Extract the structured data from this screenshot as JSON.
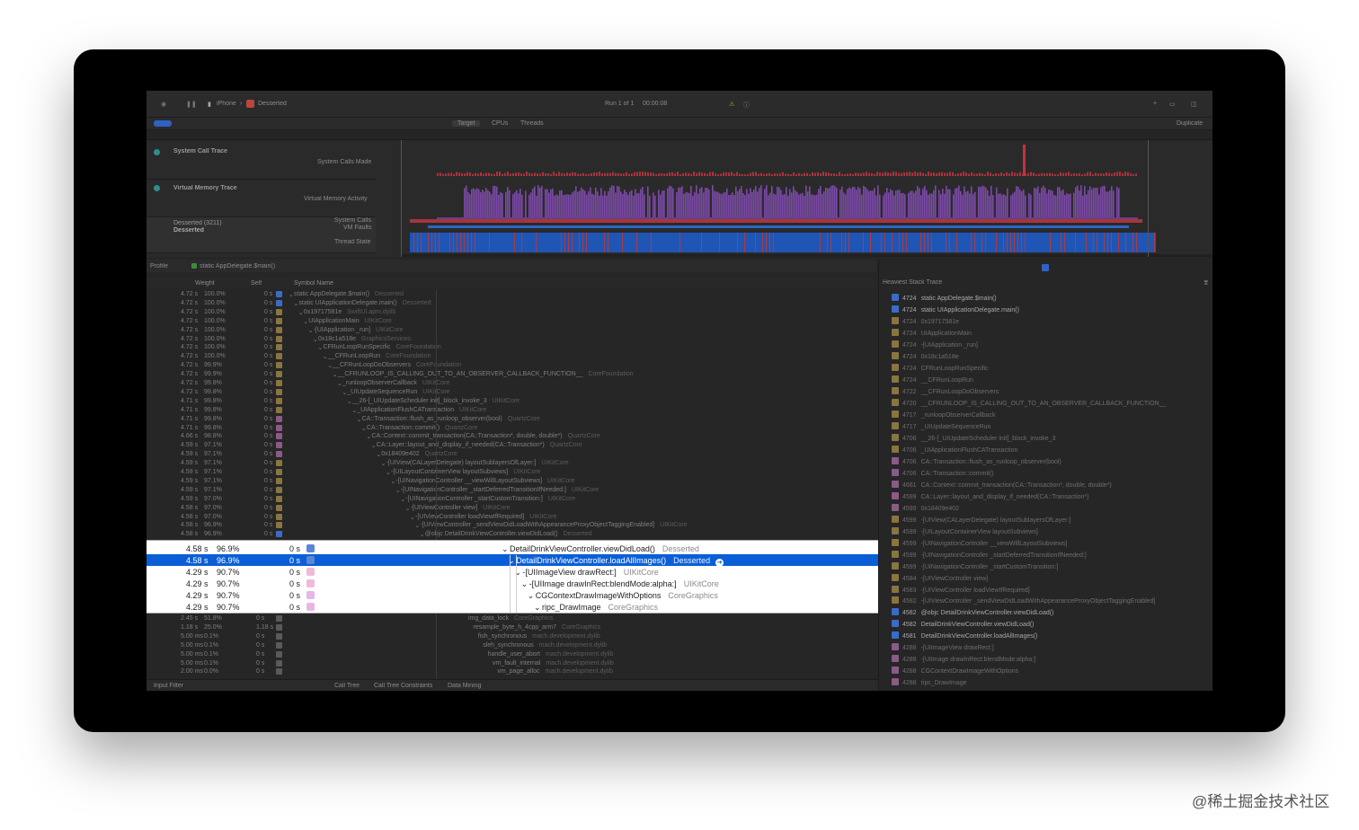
{
  "toolbar": {
    "device": "iPhone",
    "app": "Desserted",
    "run_status": "Run 1 of 1",
    "run_time": "00:00:08",
    "duplicate": "Duplicate"
  },
  "scope": {
    "tabs": [
      "Target",
      "CPUs",
      "Threads"
    ]
  },
  "tracks": [
    {
      "title": "System Call Trace",
      "subtitle": "System Calls Made"
    },
    {
      "title": "Virtual Memory Trace",
      "subtitle": "Virtual Memory Activity"
    },
    {
      "title": "Desserted (3211)",
      "name": "Desserted",
      "rows": [
        "System Calls",
        "VM Faults",
        "Thread State"
      ]
    }
  ],
  "detail": {
    "breadcrumb": "Profile",
    "root": "static AppDelegate.$main()",
    "columns": [
      "Weight",
      "Self",
      "Symbol Name"
    ]
  },
  "dim_rows": [
    {
      "w": "4.72 s",
      "p": "100.0%",
      "s": "0 s",
      "sym": "static AppDelegate.$main()",
      "lib": "Desserted",
      "d": 0,
      "c": "#3a6cc7"
    },
    {
      "w": "4.72 s",
      "p": "100.0%",
      "s": "0 s",
      "sym": "static UIApplicationDelegate.main()",
      "lib": "Desserted",
      "d": 1,
      "c": "#3a6cc7"
    },
    {
      "w": "4.72 s",
      "p": "100.0%",
      "s": "0 s",
      "sym": "0x19717581e",
      "lib": "SwiftUI.apm.dylib",
      "d": 2,
      "c": "#8a7440"
    },
    {
      "w": "4.72 s",
      "p": "100.0%",
      "s": "0 s",
      "sym": "UIApplicationMain",
      "lib": "UIKitCore",
      "d": 3,
      "c": "#8a7440"
    },
    {
      "w": "4.72 s",
      "p": "100.0%",
      "s": "0 s",
      "sym": "-[UIApplication _run]",
      "lib": "UIKitCore",
      "d": 4,
      "c": "#8a7440"
    },
    {
      "w": "4.72 s",
      "p": "100.0%",
      "s": "0 s",
      "sym": "0x18c1a518e",
      "lib": "GraphicsServices",
      "d": 5,
      "c": "#8a7440"
    },
    {
      "w": "4.72 s",
      "p": "100.0%",
      "s": "0 s",
      "sym": "CFRunLoopRunSpecific",
      "lib": "CoreFoundation",
      "d": 6,
      "c": "#8a7440"
    },
    {
      "w": "4.72 s",
      "p": "100.0%",
      "s": "0 s",
      "sym": "__CFRunLoopRun",
      "lib": "CoreFoundation",
      "d": 7,
      "c": "#8a7440"
    },
    {
      "w": "4.72 s",
      "p": "99.9%",
      "s": "0 s",
      "sym": "__CFRunLoopDoObservers",
      "lib": "CoreFoundation",
      "d": 8,
      "c": "#8a7440"
    },
    {
      "w": "4.72 s",
      "p": "99.9%",
      "s": "0 s",
      "sym": "__CFRUNLOOP_IS_CALLING_OUT_TO_AN_OBSERVER_CALLBACK_FUNCTION__",
      "lib": "CoreFoundation",
      "d": 9,
      "c": "#8a7440"
    },
    {
      "w": "4.72 s",
      "p": "99.8%",
      "s": "0 s",
      "sym": "_runloopObserverCallback",
      "lib": "UIKitCore",
      "d": 10,
      "c": "#8a7440"
    },
    {
      "w": "4.72 s",
      "p": "99.8%",
      "s": "0 s",
      "sym": "_UIUpdateSequenceRun",
      "lib": "UIKitCore",
      "d": 11,
      "c": "#8a7440"
    },
    {
      "w": "4.71 s",
      "p": "99.8%",
      "s": "0 s",
      "sym": "__26-[_UIUpdateScheduler init]_block_invoke_3",
      "lib": "UIKitCore",
      "d": 12,
      "c": "#8a7440"
    },
    {
      "w": "4.71 s",
      "p": "99.8%",
      "s": "0 s",
      "sym": "_UIApplicationFlushCATransaction",
      "lib": "UIKitCore",
      "d": 13,
      "c": "#8a7440"
    },
    {
      "w": "4.71 s",
      "p": "99.8%",
      "s": "0 s",
      "sym": "CA::Transaction::flush_as_runloop_observer(bool)",
      "lib": "QuartzCore",
      "d": 14,
      "c": "#8a5a88"
    },
    {
      "w": "4.71 s",
      "p": "99.8%",
      "s": "0 s",
      "sym": "CA::Transaction::commit()",
      "lib": "QuartzCore",
      "d": 15,
      "c": "#8a5a88"
    },
    {
      "w": "4.66 s",
      "p": "98.8%",
      "s": "0 s",
      "sym": "CA::Context::commit_transaction(CA::Transaction*, double, double*)",
      "lib": "QuartzCore",
      "d": 16,
      "c": "#8a5a88"
    },
    {
      "w": "4.59 s",
      "p": "97.1%",
      "s": "0 s",
      "sym": "CA::Layer::layout_and_display_if_needed(CA::Transaction*)",
      "lib": "QuartzCore",
      "d": 17,
      "c": "#8a5a88"
    },
    {
      "w": "4.59 s",
      "p": "97.1%",
      "s": "0 s",
      "sym": "0x18409e402",
      "lib": "QuartzCore",
      "d": 18,
      "c": "#8a5a88"
    },
    {
      "w": "4.59 s",
      "p": "97.1%",
      "s": "0 s",
      "sym": "-[UIView(CALayerDelegate) layoutSublayersOfLayer:]",
      "lib": "UIKitCore",
      "d": 19,
      "c": "#8a7440"
    },
    {
      "w": "4.59 s",
      "p": "97.1%",
      "s": "0 s",
      "sym": "-[UILayoutContainerView layoutSubviews]",
      "lib": "UIKitCore",
      "d": 20,
      "c": "#8a7440"
    },
    {
      "w": "4.59 s",
      "p": "97.1%",
      "s": "0 s",
      "sym": "-[UINavigationController __viewWillLayoutSubviews]",
      "lib": "UIKitCore",
      "d": 21,
      "c": "#8a7440"
    },
    {
      "w": "4.59 s",
      "p": "97.1%",
      "s": "0 s",
      "sym": "-[UINavigationController _startDeferredTransitionIfNeeded:]",
      "lib": "UIKitCore",
      "d": 22,
      "c": "#8a7440"
    },
    {
      "w": "4.59 s",
      "p": "97.0%",
      "s": "0 s",
      "sym": "-[UINavigationController _startCustomTransition:]",
      "lib": "UIKitCore",
      "d": 23,
      "c": "#8a7440"
    },
    {
      "w": "4.58 s",
      "p": "97.0%",
      "s": "0 s",
      "sym": "-[UIViewController view]",
      "lib": "UIKitCore",
      "d": 24,
      "c": "#8a7440"
    },
    {
      "w": "4.58 s",
      "p": "97.0%",
      "s": "0 s",
      "sym": "-[UIViewController loadViewIfRequired]",
      "lib": "UIKitCore",
      "d": 25,
      "c": "#8a7440"
    },
    {
      "w": "4.58 s",
      "p": "96.9%",
      "s": "0 s",
      "sym": "-[UIViewController _sendViewDidLoadWithAppearanceProxyObjectTaggingEnabled]",
      "lib": "UIKitCore",
      "d": 26,
      "c": "#8a7440"
    },
    {
      "w": "4.58 s",
      "p": "96.9%",
      "s": "0 s",
      "sym": "@objc DetailDrinkViewController.viewDidLoad()",
      "lib": "Desserted",
      "d": 27,
      "c": "#3a6cc7"
    }
  ],
  "highlight_rows": [
    {
      "w": "4.58 s",
      "p": "96.9%",
      "s": "0 s",
      "sym": "DetailDrinkViewController.viewDidLoad()",
      "lib": "Desserted",
      "d": 0,
      "c": "#5b86d8",
      "sel": false
    },
    {
      "w": "4.58 s",
      "p": "96.9%",
      "s": "0 s",
      "sym": "DetailDrinkViewController.loadAllImages()",
      "lib": "Desserted",
      "d": 1,
      "c": "#5b86d8",
      "sel": true
    },
    {
      "w": "4.29 s",
      "p": "90.7%",
      "s": "0 s",
      "sym": "-[UIImageView drawRect:]",
      "lib": "UIKitCore",
      "d": 2,
      "c": "#f0b9d9",
      "sel": false
    },
    {
      "w": "4.29 s",
      "p": "90.7%",
      "s": "0 s",
      "sym": "-[UIImage drawInRect:blendMode:alpha:]",
      "lib": "UIKitCore",
      "d": 3,
      "c": "#f0b9d9",
      "sel": false
    },
    {
      "w": "4.29 s",
      "p": "90.7%",
      "s": "0 s",
      "sym": "CGContextDrawImageWithOptions",
      "lib": "CoreGraphics",
      "d": 4,
      "c": "#e5b6e7",
      "sel": false
    },
    {
      "w": "4.29 s",
      "p": "90.7%",
      "s": "0 s",
      "sym": "ripc_DrawImage",
      "lib": "CoreGraphics",
      "d": 5,
      "c": "#e5b6e7",
      "sel": false
    }
  ],
  "lower_rows": [
    {
      "w": "2.45 s",
      "p": "51.8%",
      "s": "0 s",
      "sym": "img_data_lock",
      "lib": "CoreGraphics",
      "d": 0
    },
    {
      "w": "1.18 s",
      "p": "25.0%",
      "s": "1.18 s",
      "sym": "resample_byte_h_4cpp_arm7",
      "lib": "CoreGraphics",
      "d": 1
    },
    {
      "w": "5.00 ms",
      "p": "0.1%",
      "s": "0 s",
      "sym": "fish_synchronous",
      "lib": "mach.development.dylib",
      "d": 2
    },
    {
      "w": "5.00 ms",
      "p": "0.1%",
      "s": "0 s",
      "sym": "sleh_synchronous",
      "lib": "mach.development.dylib",
      "d": 3
    },
    {
      "w": "5.00 ms",
      "p": "0.1%",
      "s": "0 s",
      "sym": "handle_user_abort",
      "lib": "mach.development.dylib",
      "d": 4
    },
    {
      "w": "5.00 ms",
      "p": "0.1%",
      "s": "0 s",
      "sym": "vm_fault_internal",
      "lib": "mach.development.dylib",
      "d": 5
    },
    {
      "w": "2.00 ms",
      "p": "0.0%",
      "s": "0 s",
      "sym": "vm_page_alloc",
      "lib": "mach.development.dylib",
      "d": 6
    }
  ],
  "heaviest": {
    "title": "Heaviest Stack Trace",
    "items": [
      {
        "n": "4724",
        "t": "static AppDelegate.$main()",
        "bright": true,
        "c": "#3a6cc7"
      },
      {
        "n": "4724",
        "t": "static UIApplicationDelegate.main()",
        "bright": true,
        "c": "#3a6cc7"
      },
      {
        "n": "4724",
        "t": "0x19717581e",
        "bright": false,
        "c": "#8a7440"
      },
      {
        "n": "4724",
        "t": "UIApplicationMain",
        "bright": false,
        "c": "#8a7440"
      },
      {
        "n": "4724",
        "t": "-[UIApplication _run]",
        "bright": false,
        "c": "#8a7440"
      },
      {
        "n": "4724",
        "t": "0x18c1a518e",
        "bright": false,
        "c": "#8a7440"
      },
      {
        "n": "4724",
        "t": "CFRunLoopRunSpecific",
        "bright": false,
        "c": "#8a7440"
      },
      {
        "n": "4724",
        "t": "__CFRunLoopRun",
        "bright": false,
        "c": "#8a7440"
      },
      {
        "n": "4722",
        "t": "__CFRunLoopDoObservers",
        "bright": false,
        "c": "#8a7440"
      },
      {
        "n": "4720",
        "t": "__CFRUNLOOP_IS_CALLING_OUT_TO_AN_OBSERVER_CALLBACK_FUNCTION__",
        "bright": false,
        "c": "#8a7440"
      },
      {
        "n": "4717",
        "t": "_runloopObserverCallback",
        "bright": false,
        "c": "#8a7440"
      },
      {
        "n": "4717",
        "t": "_UIUpdateSequenceRun",
        "bright": false,
        "c": "#8a7440"
      },
      {
        "n": "4706",
        "t": "__26-[_UIUpdateScheduler init]_block_invoke_3",
        "bright": false,
        "c": "#8a7440"
      },
      {
        "n": "4706",
        "t": "_UIApplicationFlushCATransaction",
        "bright": false,
        "c": "#8a7440"
      },
      {
        "n": "4706",
        "t": "CA::Transaction::flush_as_runloop_observer(bool)",
        "bright": false,
        "c": "#8a5a88"
      },
      {
        "n": "4706",
        "t": "CA::Transaction::commit()",
        "bright": false,
        "c": "#8a5a88"
      },
      {
        "n": "4661",
        "t": "CA::Context::commit_transaction(CA::Transaction*, double, double*)",
        "bright": false,
        "c": "#8a5a88"
      },
      {
        "n": "4599",
        "t": "CA::Layer::layout_and_display_if_needed(CA::Transaction*)",
        "bright": false,
        "c": "#8a5a88"
      },
      {
        "n": "4599",
        "t": "0x18409e402",
        "bright": false,
        "c": "#8a5a88"
      },
      {
        "n": "4599",
        "t": "-[UIView(CALayerDelegate) layoutSublayersOfLayer:]",
        "bright": false,
        "c": "#8a7440"
      },
      {
        "n": "4599",
        "t": "-[UILayoutContainerView layoutSubviews]",
        "bright": false,
        "c": "#8a7440"
      },
      {
        "n": "4599",
        "t": "-[UINavigationController __viewWillLayoutSubviews]",
        "bright": false,
        "c": "#8a7440"
      },
      {
        "n": "4599",
        "t": "-[UINavigationController _startDeferredTransitionIfNeeded:]",
        "bright": false,
        "c": "#8a7440"
      },
      {
        "n": "4599",
        "t": "-[UINavigationController _startCustomTransition:]",
        "bright": false,
        "c": "#8a7440"
      },
      {
        "n": "4584",
        "t": "-[UIViewController view]",
        "bright": false,
        "c": "#8a7440"
      },
      {
        "n": "4583",
        "t": "-[UIViewController loadViewIfRequired]",
        "bright": false,
        "c": "#8a7440"
      },
      {
        "n": "4582",
        "t": "-[UIViewController _sendViewDidLoadWithAppearanceProxyObjectTaggingEnabled]",
        "bright": false,
        "c": "#8a7440"
      },
      {
        "n": "4582",
        "t": "@objc DetailDrinkViewController.viewDidLoad()",
        "bright": true,
        "c": "#3a6cc7"
      },
      {
        "n": "4582",
        "t": "DetailDrinkViewController.viewDidLoad()",
        "bright": true,
        "c": "#3a6cc7"
      },
      {
        "n": "4581",
        "t": "DetailDrinkViewController.loadAllImages()",
        "bright": true,
        "c": "#3a6cc7"
      },
      {
        "n": "4288",
        "t": "-[UIImageView drawRect:]",
        "bright": false,
        "c": "#8a5a88"
      },
      {
        "n": "4288",
        "t": "-[UIImage drawInRect:blendMode:alpha:]",
        "bright": false,
        "c": "#8a5a88"
      },
      {
        "n": "4288",
        "t": "CGContextDrawImageWithOptions",
        "bright": false,
        "c": "#8a5a88"
      },
      {
        "n": "4288",
        "t": "ripc_DrawImage",
        "bright": false,
        "c": "#8a5a88"
      }
    ]
  },
  "bottom": {
    "filter": "Input Filter",
    "tabs": [
      "Call Tree",
      "Call Tree Constraints",
      "Data Mining"
    ]
  },
  "watermark": "@稀土掘金技术社区"
}
